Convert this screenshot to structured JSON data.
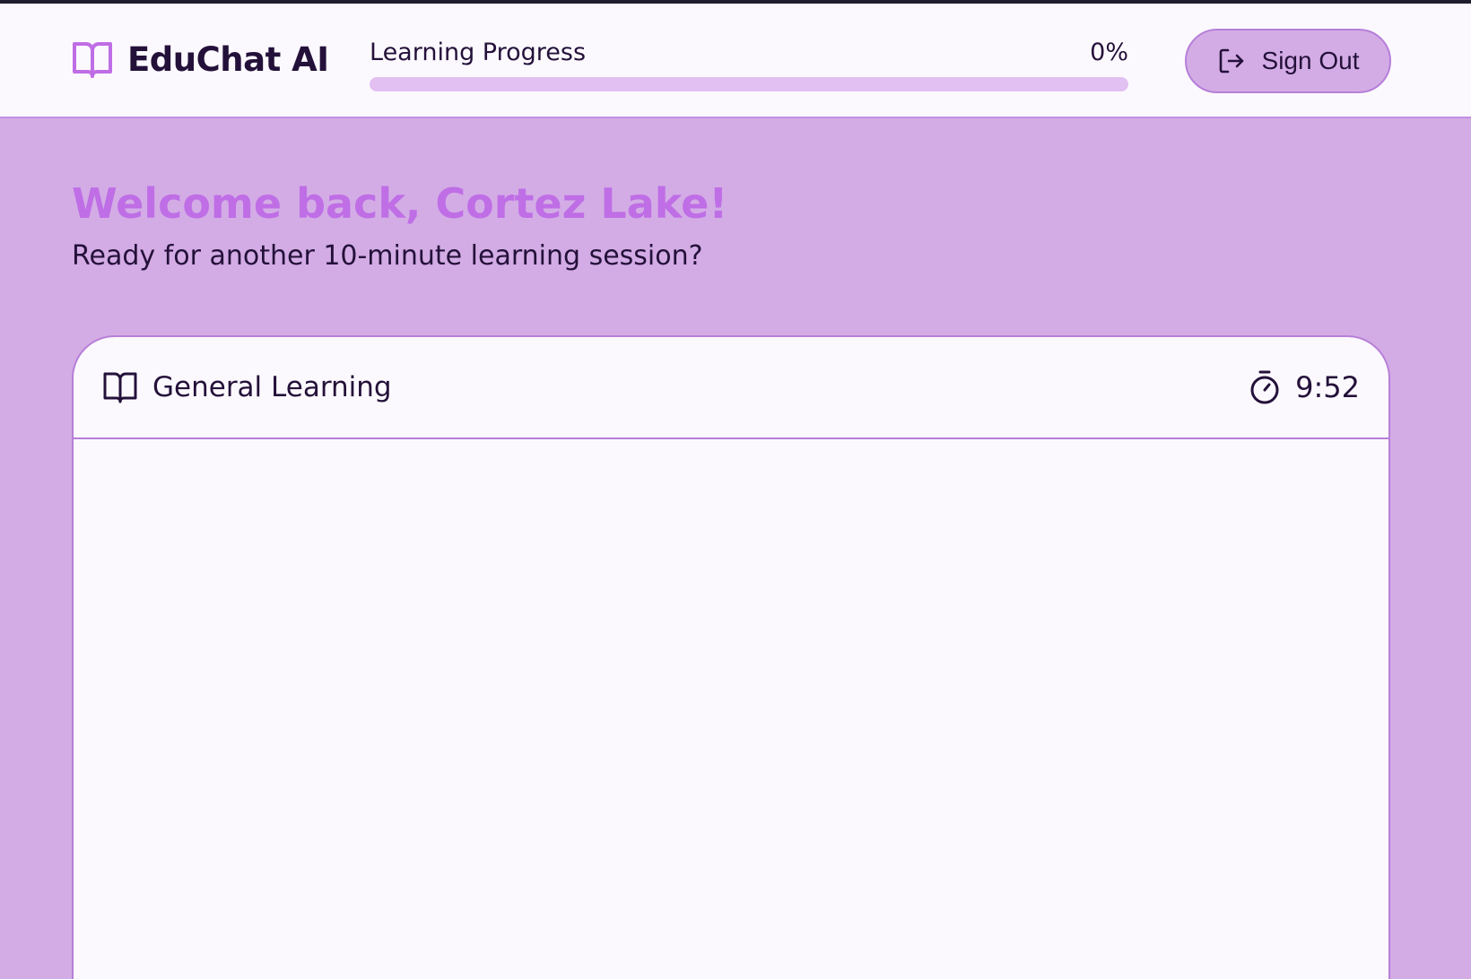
{
  "app": {
    "title": "EduChat AI",
    "icon": "book-open-icon",
    "accent_color": "#bf6ee6",
    "background_color": "#d3ace5"
  },
  "progress": {
    "label": "Learning Progress",
    "value_text": "0%",
    "value": 0
  },
  "header": {
    "signout_label": "Sign Out",
    "signout_icon": "sign-out-icon"
  },
  "welcome": {
    "title": "Welcome back, Cortez Lake!",
    "subtitle": "Ready for another 10-minute learning session?"
  },
  "session": {
    "topic_icon": "book-open-icon",
    "topic": "General Learning",
    "timer_icon": "stopwatch-icon",
    "timer": "9:52"
  }
}
